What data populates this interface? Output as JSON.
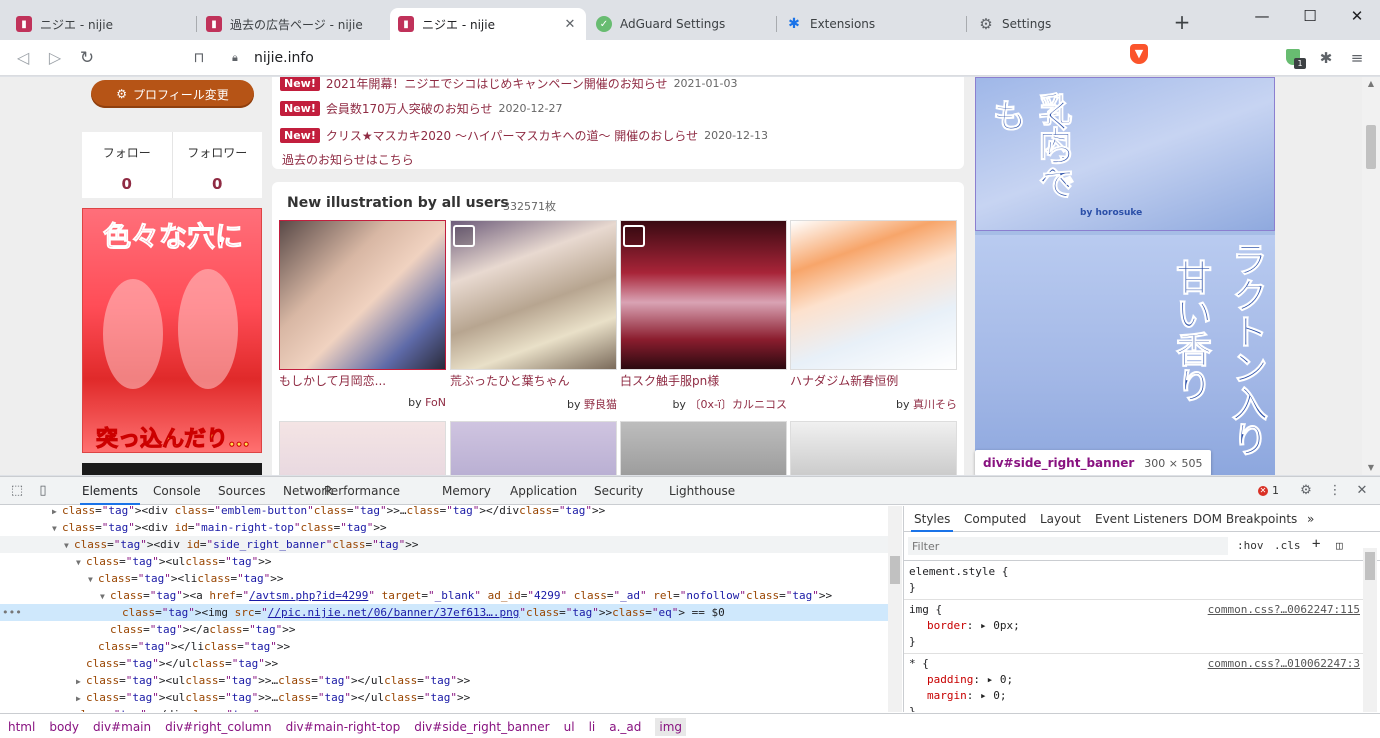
{
  "tabs": [
    {
      "title": "ニジエ - nijie",
      "icon": "nijie-icon",
      "active": false
    },
    {
      "title": "過去の広告ページ - nijie",
      "icon": "nijie-icon",
      "active": false
    },
    {
      "title": "ニジエ - nijie",
      "icon": "nijie-icon",
      "active": true
    },
    {
      "title": "AdGuard Settings",
      "icon": "adguard-icon",
      "active": false
    },
    {
      "title": "Extensions",
      "icon": "puzzle-icon",
      "active": false
    },
    {
      "title": "Settings",
      "icon": "gear-icon",
      "active": false
    }
  ],
  "toolbar": {
    "url": "nijie.info",
    "adguard_badge": "1"
  },
  "page": {
    "profile_button": "プロフィール変更",
    "follow_label": "フォロー",
    "follow_count": "0",
    "follower_label": "フォロワー",
    "follower_count": "0",
    "left_banner_top": "色々な穴に",
    "left_banner_bottom": "突っ込んだり…",
    "news": [
      {
        "badge": "New!",
        "text": "2021年開幕！ニジエでシコはじめキャンペーン開催のお知らせ",
        "date": "2021-01-03"
      },
      {
        "badge": "New!",
        "text": "会員数170万人突破のお知らせ",
        "date": "2020-12-27"
      },
      {
        "badge": "New!",
        "text": "クリス★マスカキ2020 ～ハイパーマスカキへの道～ 開催のおしらせ",
        "date": "2020-12-13"
      }
    ],
    "news_more": "過去のお知らせはこちら",
    "illust_title": "New illustration by all users",
    "illust_count": "332571枚",
    "illusts": [
      {
        "name": "もしかして月岡恋...",
        "by_label": "by",
        "author": "FoN"
      },
      {
        "name": "荒ぶったひと葉ちゃん",
        "by_label": "by",
        "author": "野良猫"
      },
      {
        "name": "白スク触手服pn様",
        "by_label": "by",
        "author": "〔0x-ï〕カルニコス"
      },
      {
        "name": "ハナダジム新春恒例",
        "by_label": "by",
        "author": "真川そら"
      }
    ],
    "right_banner_text1": "乳内へ",
    "right_banner_text2": "くらでも",
    "right_banner_text3": "ラクトン入り",
    "right_banner_text4": "甘い香り",
    "right_banner_brand": "by horosuke",
    "tooltip_selector": "div#side_right_banner",
    "tooltip_size": "300 × 505"
  },
  "devtools": {
    "tabs": [
      "Elements",
      "Console",
      "Sources",
      "Network",
      "Performance",
      "Memory",
      "Application",
      "Security",
      "Lighthouse"
    ],
    "error_count": "1",
    "dom": [
      {
        "indent": 4,
        "tri": "▶",
        "html": "<div class=\"emblem-button\">…</div>"
      },
      {
        "indent": 4,
        "tri": "▼",
        "html": "<div id=\"main-right-top\">"
      },
      {
        "indent": 5,
        "tri": "▼",
        "html": "<div id=\"side_right_banner\">"
      },
      {
        "indent": 6,
        "tri": "▼",
        "html": "<ul>"
      },
      {
        "indent": 7,
        "tri": "▼",
        "html": "<li>"
      },
      {
        "indent": 8,
        "tri": "▼",
        "html": "<a href=\"/avtsm.php?id=4299\" target=\"_blank\" ad_id=\"4299\" class=\"_ad\" rel=\"nofollow\">"
      },
      {
        "indent": 9,
        "tri": "",
        "html": "<img src=\"//pic.nijie.net/06/banner/37ef613….png\"> == $0"
      },
      {
        "indent": 8,
        "tri": "",
        "html": "</a>"
      },
      {
        "indent": 7,
        "tri": "",
        "html": "</li>"
      },
      {
        "indent": 6,
        "tri": "",
        "html": "</ul>"
      },
      {
        "indent": 6,
        "tri": "▶",
        "html": "<ul>…</ul>"
      },
      {
        "indent": 6,
        "tri": "▶",
        "html": "<ul>…</ul>"
      },
      {
        "indent": 5,
        "tri": "",
        "html": "</div>"
      }
    ],
    "styles_tabs": [
      "Styles",
      "Computed",
      "Layout",
      "Event Listeners",
      "DOM Breakpoints"
    ],
    "filter_placeholder": "Filter",
    "hov": ":hov",
    "cls": ".cls",
    "rules": [
      {
        "selector": "element.style {",
        "source": "",
        "props": [],
        "close": "}"
      },
      {
        "selector": "img {",
        "source": "common.css?…0062247:115",
        "props": [
          {
            "name": "border",
            "value": "0px;"
          }
        ],
        "close": "}"
      },
      {
        "selector": "* {",
        "source": "common.css?…010062247:3",
        "props": [
          {
            "name": "padding",
            "value": "0;"
          },
          {
            "name": "margin",
            "value": "0;"
          }
        ],
        "close": "}"
      }
    ],
    "breadcrumbs": [
      "html",
      "body",
      "div#main",
      "div#right_column",
      "div#main-right-top",
      "div#side_right_banner",
      "ul",
      "li",
      "a._ad",
      "img"
    ]
  }
}
